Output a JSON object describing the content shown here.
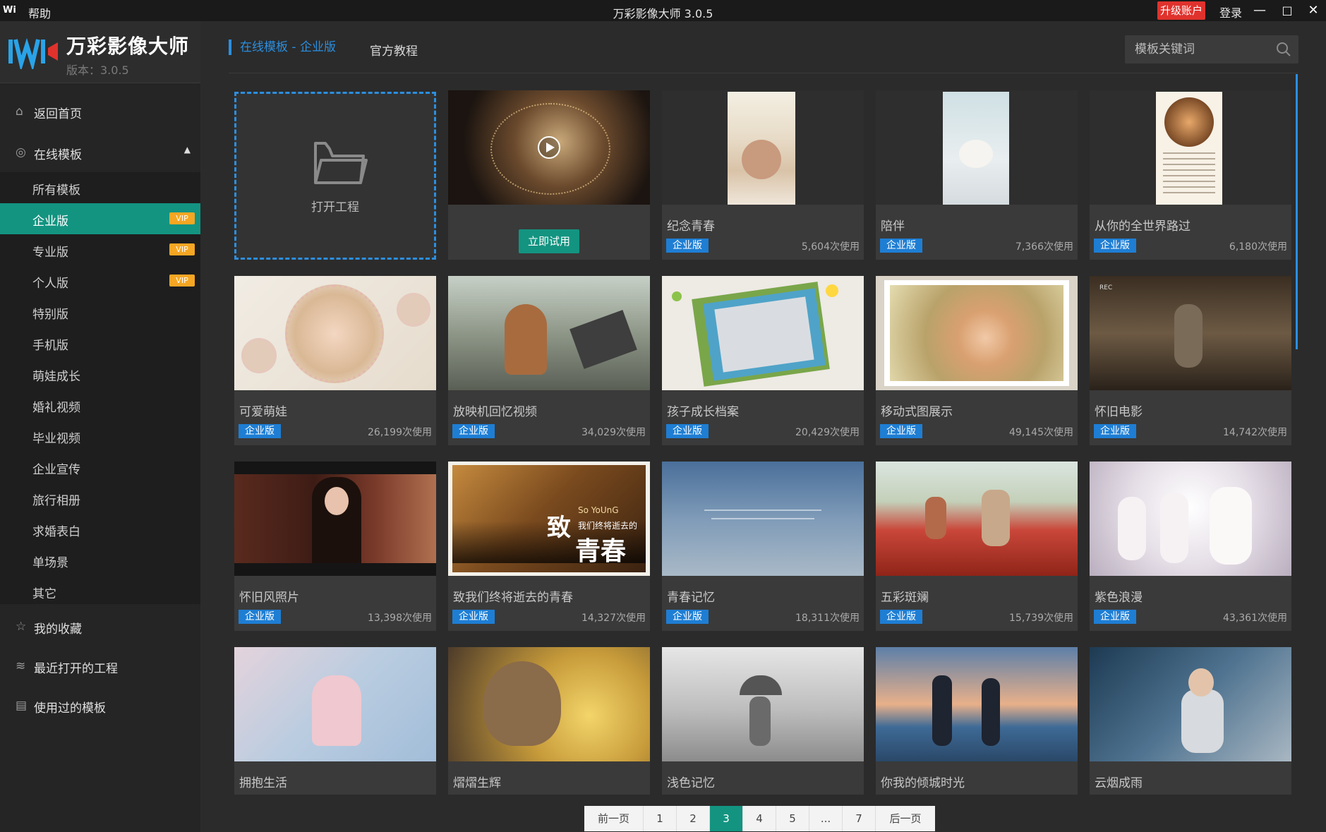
{
  "window": {
    "logo_text": "Wi",
    "help": "帮助",
    "title": "万彩影像大师 3.0.5",
    "upgrade": "升级账户",
    "login": "登录",
    "minimize": "—",
    "maximize": "□",
    "close": "✕"
  },
  "brand": {
    "name": "万彩影像大师",
    "version": "版本：3.0.5"
  },
  "sidebar": {
    "home": "返回首页",
    "online_templates": "在线模板",
    "sub_items": [
      {
        "label": "所有模板"
      },
      {
        "label": "企业版",
        "vip": "VIP"
      },
      {
        "label": "专业版",
        "vip": "VIP"
      },
      {
        "label": "个人版",
        "vip": "VIP"
      },
      {
        "label": "特别版"
      },
      {
        "label": "手机版"
      },
      {
        "label": "萌娃成长"
      },
      {
        "label": "婚礼视频"
      },
      {
        "label": "毕业视频"
      },
      {
        "label": "企业宣传"
      },
      {
        "label": "旅行相册"
      },
      {
        "label": "求婚表白"
      },
      {
        "label": "单场景"
      },
      {
        "label": "其它"
      }
    ],
    "favorites": "我的收藏",
    "recent_projects": "最近打开的工程",
    "used_templates": "使用过的模板"
  },
  "header": {
    "active_tab": "在线模板 - 企业版",
    "tutorial_tab": "官方教程",
    "search_placeholder": "模板关键词"
  },
  "open_project": "打开工程",
  "try_now": "立即试用",
  "cards": [
    {
      "title": "纪念青春",
      "badge": "企业版",
      "uses": "5,604次使用"
    },
    {
      "title": "陪伴",
      "badge": "企业版",
      "uses": "7,366次使用"
    },
    {
      "title": "从你的全世界路过",
      "badge": "企业版",
      "uses": "6,180次使用"
    },
    {
      "title": "可爱萌娃",
      "badge": "企业版",
      "uses": "26,199次使用"
    },
    {
      "title": "放映机回忆视频",
      "badge": "企业版",
      "uses": "34,029次使用"
    },
    {
      "title": "孩子成长档案",
      "badge": "企业版",
      "uses": "20,429次使用"
    },
    {
      "title": "移动式图展示",
      "badge": "企业版",
      "uses": "49,145次使用"
    },
    {
      "title": "怀旧电影",
      "badge": "企业版",
      "uses": "14,742次使用"
    },
    {
      "title": "怀旧风照片",
      "badge": "企业版",
      "uses": "13,398次使用"
    },
    {
      "title": "致我们终将逝去的青春",
      "badge": "企业版",
      "uses": "14,327次使用"
    },
    {
      "title": "青春记忆",
      "badge": "企业版",
      "uses": "18,311次使用"
    },
    {
      "title": "五彩斑斓",
      "badge": "企业版",
      "uses": "15,739次使用"
    },
    {
      "title": "紫色浪漫",
      "badge": "企业版",
      "uses": "43,361次使用"
    },
    {
      "title": "拥抱生活"
    },
    {
      "title": "熠熠生辉"
    },
    {
      "title": "浅色记忆"
    },
    {
      "title": "你我的倾城时光"
    },
    {
      "title": "云烟成雨"
    }
  ],
  "thumb_text": {
    "so_young": "So YoUnG",
    "zhi": "致",
    "subtitle": "我们终将逝去的",
    "qingchun": "青春",
    "rec": "REC"
  },
  "pagination": {
    "prev": "前一页",
    "pages": [
      "1",
      "2",
      "3",
      "4",
      "5",
      "...",
      "7"
    ],
    "current": "3",
    "next": "后一页"
  },
  "colors": {
    "accent_teal": "#139481",
    "accent_blue": "#2b8fe0",
    "upgrade_red": "#e0322d",
    "vip_orange": "#f5a623",
    "badge_blue": "#1e7ed4"
  },
  "icons": {
    "home": "home-icon",
    "online": "globe-icon",
    "favorites": "star-icon",
    "recent": "layers-icon",
    "used": "template-icon",
    "search": "search-icon",
    "folder": "folder-icon",
    "play": "play-icon"
  }
}
